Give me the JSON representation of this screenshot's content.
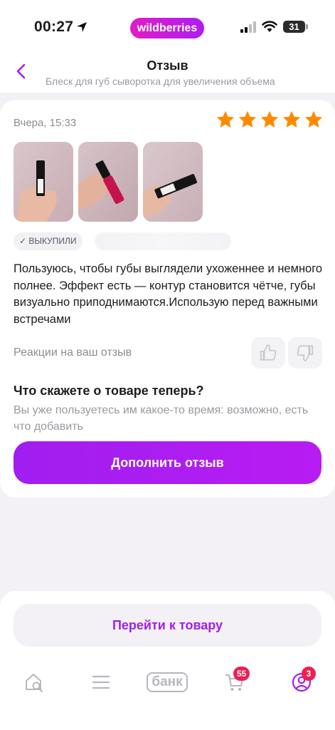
{
  "status_bar": {
    "time": "00:27",
    "brand": "wildberries",
    "battery": "31"
  },
  "header": {
    "title": "Отзыв",
    "subtitle": "Блеск для губ сыворотка для увеличения объема"
  },
  "review": {
    "date": "Вчера, 15:33",
    "rating": 5,
    "bought_badge": "ВЫКУПИЛИ",
    "text": "Пользуюсь, чтобы губы выглядели ухоженнее и немного полнее. Эффект есть — контур становится чётче, губы визуально приподнимаются.Использую перед важными встречами",
    "reactions_label": "Реакции на ваш отзыв",
    "prompt_title": "Что скажете о товаре теперь?",
    "prompt_text": "Вы уже пользуетесь им какое-то время: возможно, есть что добавить",
    "add_button": "Дополнить отзыв"
  },
  "bottom": {
    "goto_button": "Перейти к товару",
    "tabs": {
      "home_icon": "home-search-icon",
      "catalog_icon": "menu-icon",
      "bank_label": "банк",
      "cart_icon": "cart-icon",
      "cart_badge": "55",
      "profile_icon": "profile-icon",
      "profile_badge": "3"
    }
  },
  "colors": {
    "accent": "#a51ef0",
    "star": "#ff8a00",
    "badge": "#ee1f51"
  }
}
